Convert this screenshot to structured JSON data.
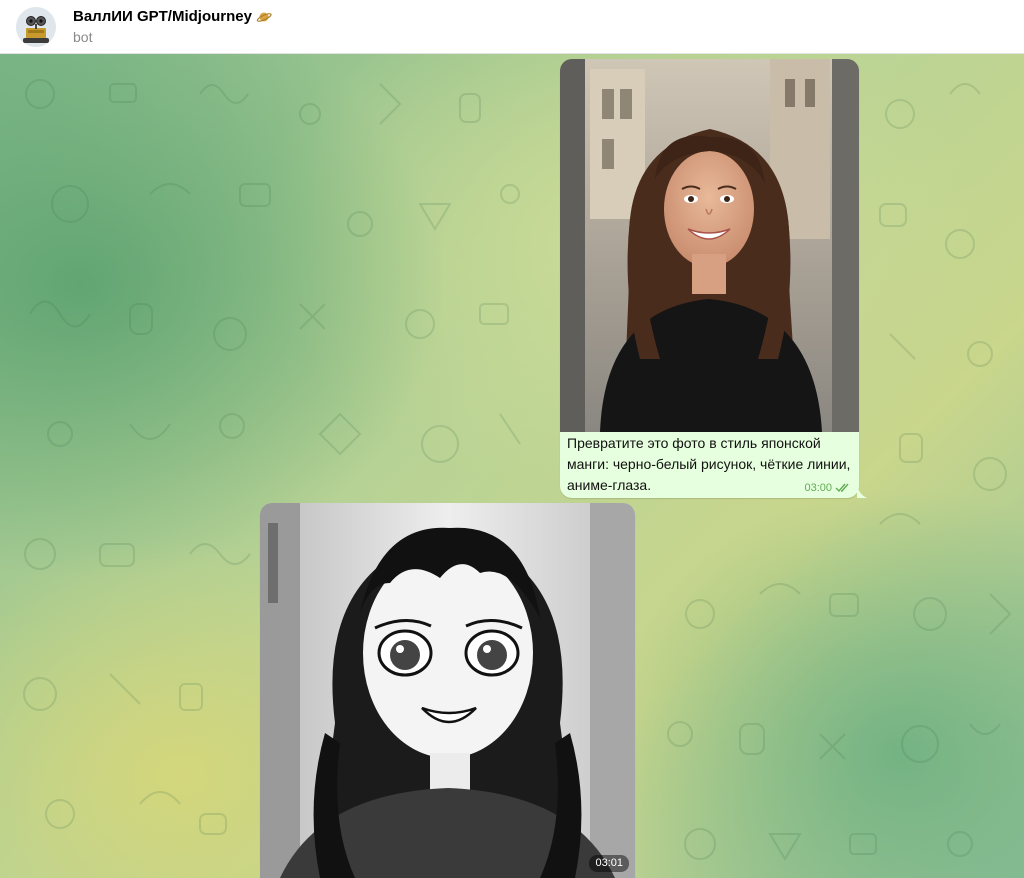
{
  "header": {
    "title": "ВаллИИ GPT/Midjourney",
    "subtitle": "bot",
    "avatar_icon": "robot-avatar-icon",
    "title_emoji_icon": "planet-icon"
  },
  "messages": {
    "outgoing": {
      "image_alt": "photo-of-smiling-woman-icon",
      "caption": "Превратите это фото в стиль японской манги: черно-белый рисунок, чёткие линии, аниме-глаза.",
      "time": "03:00",
      "status_icon": "double-check-icon"
    },
    "incoming": {
      "image_alt": "manga-style-girl-illustration-icon",
      "time": "03:01"
    }
  },
  "colors": {
    "outgoing_bubble": "#e6ffde",
    "outgoing_meta": "#62ac55",
    "header_bg": "#ffffff"
  }
}
